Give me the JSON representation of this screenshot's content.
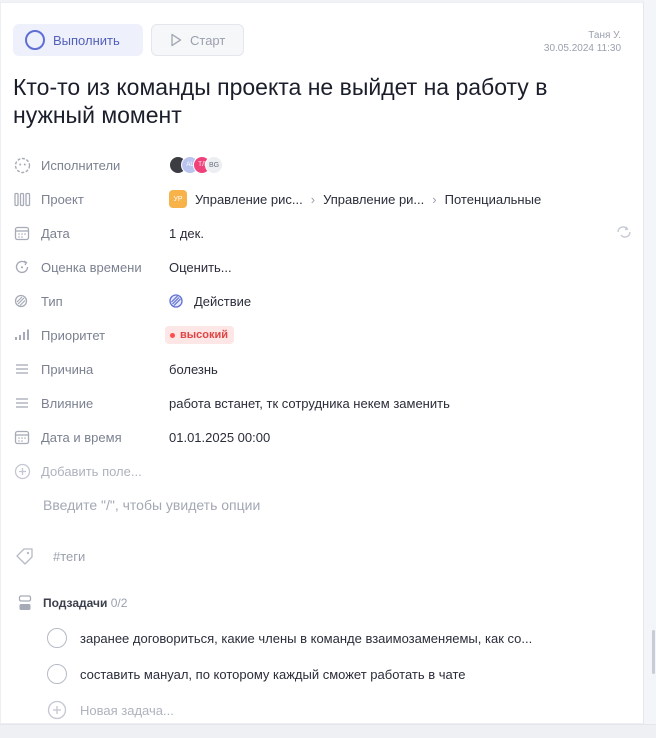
{
  "toolbar": {
    "complete_label": "Выполнить",
    "start_label": "Старт"
  },
  "author": {
    "name": "Таня У.",
    "timestamp": "30.05.2024 11:30"
  },
  "task": {
    "title": "Кто-то из команды проекта не выйдет на работу в нужный момент"
  },
  "props": {
    "assignees": {
      "label": "Исполнители",
      "avatars": [
        "",
        "AL",
        "TЛ",
        "BG"
      ]
    },
    "project": {
      "label": "Проект",
      "badge": "УР",
      "path": [
        "Управление рис...",
        "Управление ри...",
        "Потенциальные"
      ]
    },
    "date": {
      "label": "Дата",
      "value": "1 дек."
    },
    "estimate": {
      "label": "Оценка времени",
      "value": "Оценить..."
    },
    "type": {
      "label": "Тип",
      "value": "Действие"
    },
    "priority": {
      "label": "Приоритет",
      "value": "высокий"
    },
    "reason": {
      "label": "Причина",
      "value": "болезнь"
    },
    "impact": {
      "label": "Влияние",
      "value": "работа встанет, тк сотрудника некем заменить"
    },
    "datetime": {
      "label": "Дата и время",
      "value": "01.01.2025 00:00"
    },
    "add_field": {
      "label": "Добавить поле..."
    }
  },
  "editor": {
    "placeholder": "Введите \"/\", чтобы увидеть опции"
  },
  "tags": {
    "placeholder": "#теги"
  },
  "subtasks": {
    "label": "Подзадачи",
    "count": "0/2",
    "items": [
      "заранее договориться, какие члены в команде взаимозаменяемы, как со...",
      "составить мануал, по которому каждый сможет работать в чате"
    ],
    "new_task": "Новая задача..."
  },
  "colors": {
    "accent": "#5f6fd4",
    "priority_high": "#e04444",
    "project_badge": "#f7b24a"
  }
}
